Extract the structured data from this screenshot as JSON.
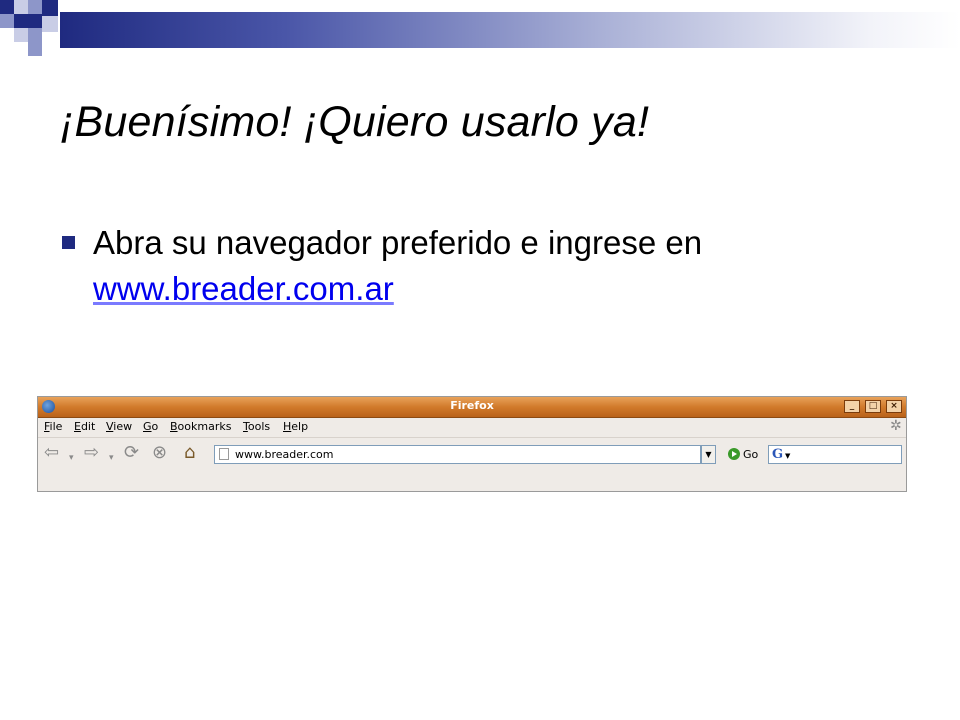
{
  "slide": {
    "title": "¡Buenísimo! ¡Quiero usarlo ya!",
    "bullet_text": "Abra su navegador preferido e ingrese en ",
    "bullet_link": "www.breader.com.ar"
  },
  "browser": {
    "window_title": "Firefox",
    "menu": [
      {
        "accel": "F",
        "rest": "ile"
      },
      {
        "accel": "E",
        "rest": "dit"
      },
      {
        "accel": "V",
        "rest": "iew"
      },
      {
        "accel": "G",
        "rest": "o"
      },
      {
        "accel": "B",
        "rest": "ookmarks"
      },
      {
        "accel": "T",
        "rest": "ools"
      },
      {
        "accel": "H",
        "rest": "elp"
      }
    ],
    "url": "www.breader.com",
    "go_label": "Go",
    "search_engine_glyph": "G"
  },
  "colors": {
    "accent": "#1f2a80",
    "link": "#0000ee",
    "titlebar": "#d17a2b"
  }
}
